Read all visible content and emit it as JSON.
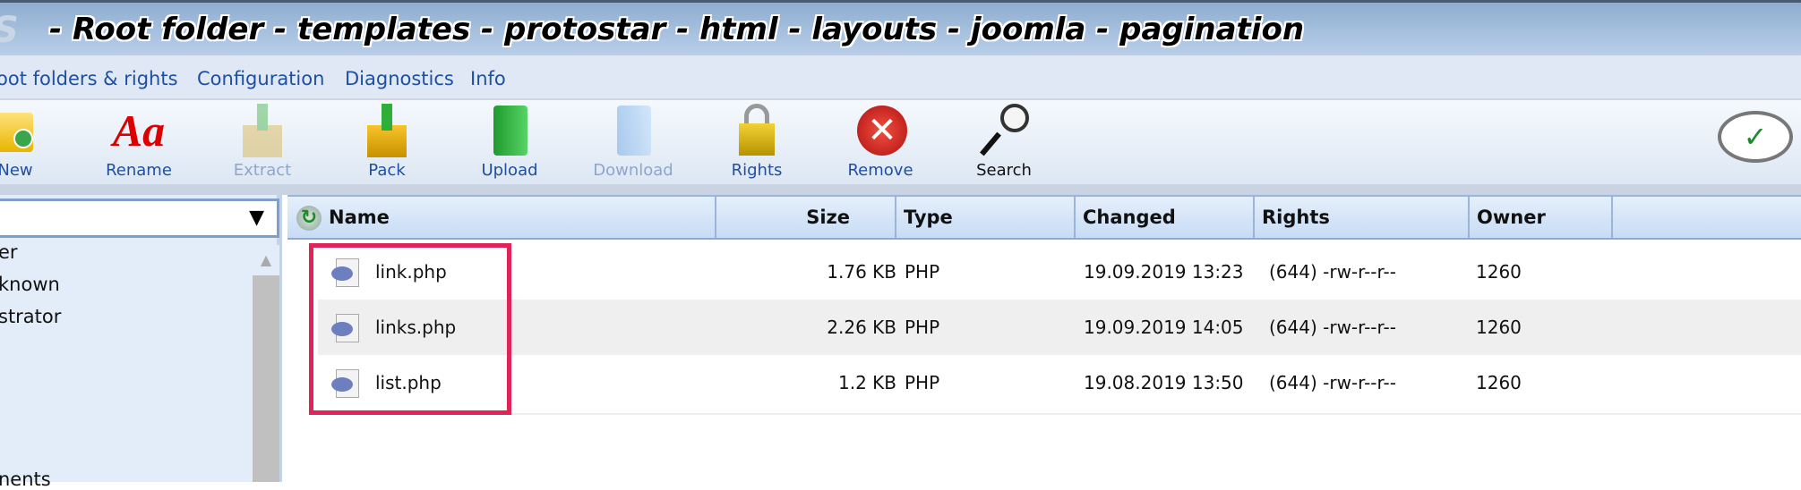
{
  "title": {
    "logo": "S",
    "path": "- Root folder - templates - protostar - html - layouts - joomla - pagination"
  },
  "menu": [
    "oot folders & rights",
    "Configuration",
    "Diagnostics",
    "Info"
  ],
  "toolbar": [
    {
      "label": "New",
      "icon": "new-folder-icon"
    },
    {
      "label": "Rename",
      "icon": "rename-icon"
    },
    {
      "label": "Extract",
      "icon": "extract-icon",
      "disabled": true
    },
    {
      "label": "Pack",
      "icon": "pack-icon"
    },
    {
      "label": "Upload",
      "icon": "upload-icon"
    },
    {
      "label": "Download",
      "icon": "download-icon",
      "disabled": true
    },
    {
      "label": "Rights",
      "icon": "lock-icon"
    },
    {
      "label": "Remove",
      "icon": "remove-icon"
    },
    {
      "label": "Search",
      "icon": "search-icon"
    }
  ],
  "left": {
    "dropdown_arrow": "▼",
    "tree": [
      "er",
      "known",
      "strator",
      "nents"
    ],
    "scroll_up": "▲"
  },
  "table": {
    "headers": [
      "Name",
      "Size",
      "Type",
      "Changed",
      "Rights",
      "Owner"
    ],
    "rows": [
      {
        "name": "link.php",
        "size": "1.76 KB",
        "type": "PHP",
        "changed": "19.09.2019 13:23",
        "rights": "(644) -rw-r--r--",
        "owner": "1260"
      },
      {
        "name": "links.php",
        "size": "2.26 KB",
        "type": "PHP",
        "changed": "19.09.2019 14:05",
        "rights": "(644) -rw-r--r--",
        "owner": "1260"
      },
      {
        "name": "list.php",
        "size": "1.2 KB",
        "type": "PHP",
        "changed": "19.08.2019 13:50",
        "rights": "(644) -rw-r--r--",
        "owner": "1260"
      }
    ]
  },
  "colors": {
    "highlight": "#e0245a",
    "link": "#1f4fa3"
  }
}
